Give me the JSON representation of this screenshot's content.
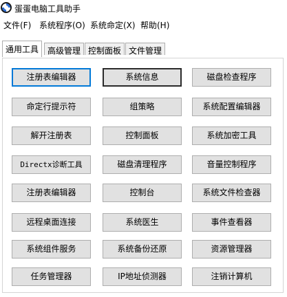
{
  "window": {
    "title": "蛋蛋电脑工具助手",
    "icon": "app-logo-icon"
  },
  "menu": [
    {
      "label": "文件(F)"
    },
    {
      "label": "系统程序(O)"
    },
    {
      "label": "系统命定(X)"
    },
    {
      "label": "帮助(H)"
    }
  ],
  "tabs": [
    {
      "label": "通用工具",
      "active": true
    },
    {
      "label": "高级管理",
      "active": false
    },
    {
      "label": "控制面板",
      "active": false
    },
    {
      "label": "文件管理",
      "active": false
    }
  ],
  "buttons": [
    [
      "注册表编辑器",
      "系统信息",
      "磁盘检查程序"
    ],
    [
      "命定行提示符",
      "组策略",
      "系统配置编辑器"
    ],
    [
      "解开注册表",
      "控制面板",
      "系统加密工具"
    ],
    [
      "Directx诊断工具",
      "磁盘清理程序",
      "音量控制程序"
    ],
    [
      "注册表编辑器",
      "控制台",
      "系统文件检查器"
    ],
    [
      "远程桌面连接",
      "系统医生",
      "事件查看器"
    ],
    [
      "系统组件服务",
      "系统备份还原",
      "资源管理器"
    ],
    [
      "任务管理器",
      "IP地址侦测器",
      "注销计算机"
    ]
  ],
  "colors": {
    "focus_border": "#0078d7",
    "button_face": "#e1e1e1"
  }
}
